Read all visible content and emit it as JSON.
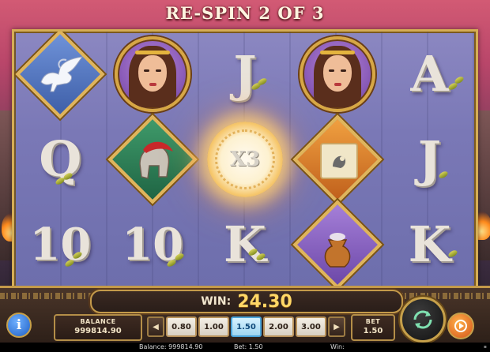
{
  "title": "RE-SPIN 2 OF 3",
  "reels": {
    "row1": [
      {
        "symbol": "pegasus",
        "icon": "pegasus-icon"
      },
      {
        "symbol": "goddess",
        "icon": "goddess-portrait-icon"
      },
      {
        "symbol": "J"
      },
      {
        "symbol": "goddess",
        "icon": "goddess-portrait-icon"
      },
      {
        "symbol": "A"
      }
    ],
    "row2": [
      {
        "symbol": "Q"
      },
      {
        "symbol": "helmet",
        "icon": "spartan-helmet-icon"
      },
      {
        "symbol": "multiplier",
        "text": "X3"
      },
      {
        "symbol": "scroll",
        "icon": "scroll-icon"
      },
      {
        "symbol": "J"
      }
    ],
    "row3": [
      {
        "symbol": "10"
      },
      {
        "symbol": "10"
      },
      {
        "symbol": "K"
      },
      {
        "symbol": "vase",
        "icon": "vase-icon"
      },
      {
        "symbol": "K"
      }
    ]
  },
  "win": {
    "label": "WIN:",
    "value": "24.30"
  },
  "balance": {
    "label": "BALANCE",
    "value": "999814.90"
  },
  "bet": {
    "label": "BET",
    "value": "1.50",
    "options": [
      "0.80",
      "1.00",
      "1.50",
      "2.00",
      "3.00"
    ],
    "selected": "1.50"
  },
  "controls": {
    "info": "i",
    "prev_arrow": "◀",
    "next_arrow": "▶"
  },
  "status_bar": {
    "balance": "Balance: 999814.90",
    "bet": "Bet: 1.50",
    "win": "Win:"
  },
  "colors": {
    "gold": "#d5ad55",
    "win_value": "#ffd766",
    "selected_bet": "#9fd6f0"
  }
}
